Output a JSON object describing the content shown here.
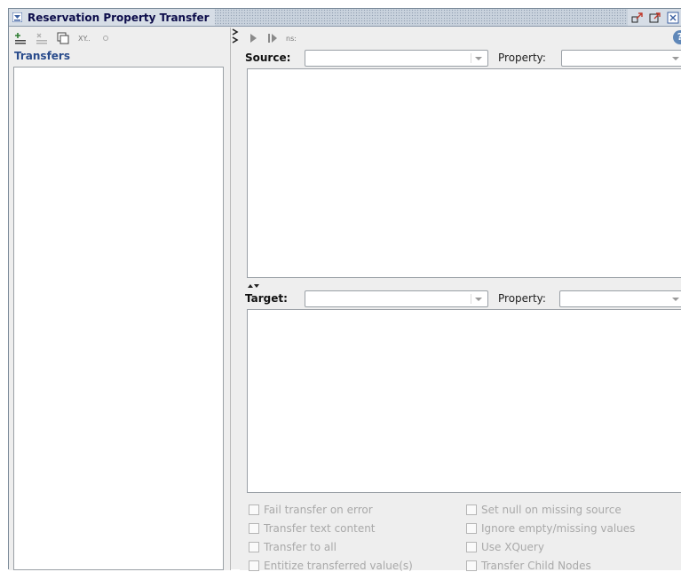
{
  "window": {
    "title": "Reservation Property Transfer"
  },
  "left_pane": {
    "toolbar": {
      "icons": [
        "add-transfer-icon",
        "remove-transfer-icon",
        "copy-icon",
        "xpath-icon",
        "status-dot-icon"
      ],
      "xy_label": "XY.."
    },
    "heading": "Transfers",
    "items": []
  },
  "right_pane": {
    "toolbar": {
      "icons": [
        "run-icon",
        "run-all-icon",
        "namespace-icon",
        "help-icon"
      ],
      "ns_label": "ns:",
      "help_glyph": "?"
    },
    "source": {
      "label": "Source:",
      "value": "",
      "property_label": "Property:",
      "property_value": ""
    },
    "target": {
      "label": "Target:",
      "value": "",
      "property_label": "Property:",
      "property_value": ""
    },
    "options": {
      "left": [
        {
          "label": "Fail transfer on error",
          "checked": false
        },
        {
          "label": "Transfer text content",
          "checked": false
        },
        {
          "label": "Transfer to all",
          "checked": false
        },
        {
          "label": "Entitize transferred value(s)",
          "checked": false
        }
      ],
      "right": [
        {
          "label": "Set null on missing source",
          "checked": false
        },
        {
          "label": "Ignore empty/missing values",
          "checked": false
        },
        {
          "label": "Use XQuery",
          "checked": false
        },
        {
          "label": "Transfer Child Nodes",
          "checked": false
        }
      ]
    }
  }
}
